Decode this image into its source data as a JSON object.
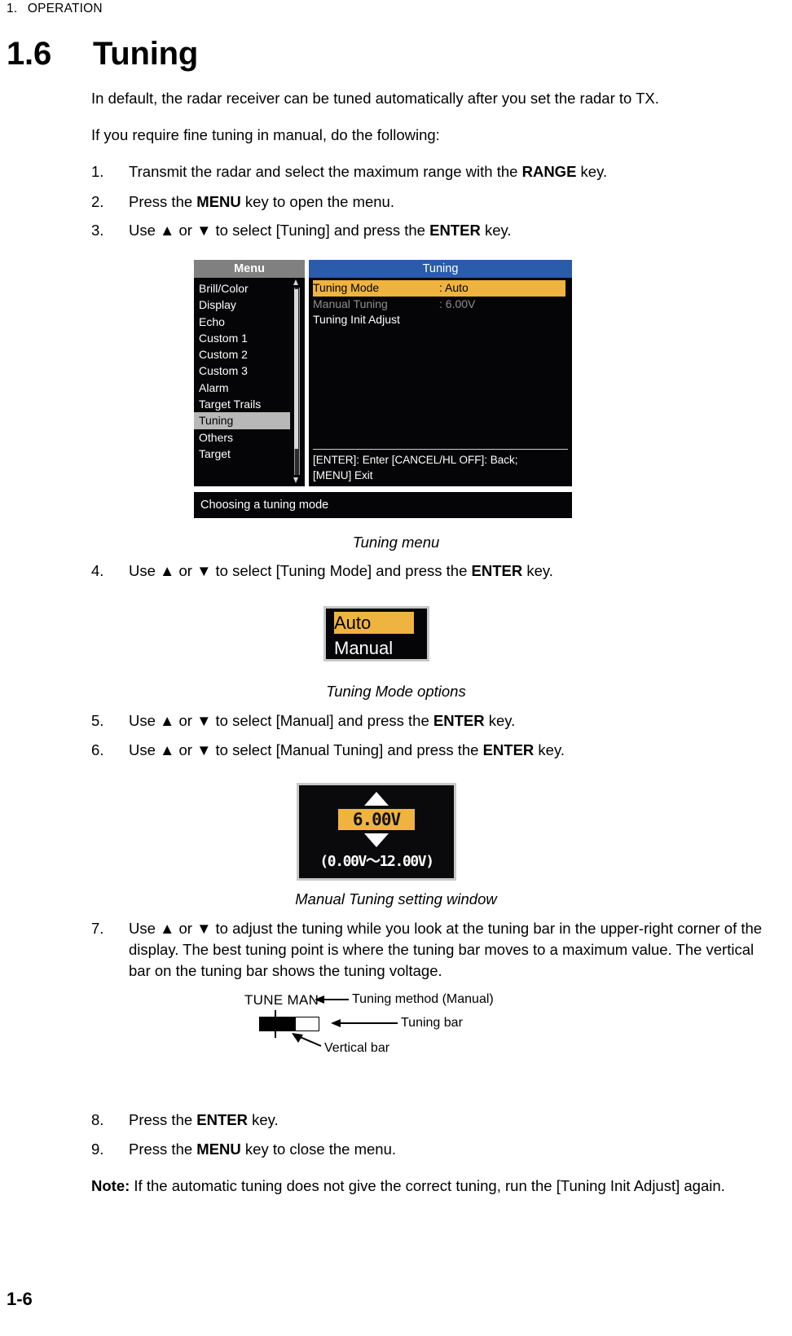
{
  "running_head": {
    "number": "1.",
    "title": "OPERATION"
  },
  "section": {
    "number": "1.6",
    "title": "Tuning"
  },
  "intro": {
    "paragraph1": "In default, the radar receiver can be tuned automatically after you set the radar to TX.",
    "paragraph2": "If you require fine tuning in manual, do the following:"
  },
  "steps": {
    "s1": {
      "num": "1.",
      "pre": "Transmit the radar and select the maximum range with the ",
      "key": "RANGE",
      "post": " key."
    },
    "s2": {
      "num": "2.",
      "pre": "Press the ",
      "key": "MENU",
      "post": " key to open the menu."
    },
    "s3": {
      "num": "3.",
      "pre": "Use ▲ or ▼ to select [Tuning] and press the ",
      "key": "ENTER",
      "post": " key."
    },
    "s4": {
      "num": "4.",
      "pre": "Use ▲ or ▼ to select [Tuning Mode] and press the ",
      "key": "ENTER",
      "post": " key."
    },
    "s5": {
      "num": "5.",
      "pre": "Use ▲ or ▼ to select [Manual] and press the ",
      "key": "ENTER",
      "post": " key."
    },
    "s6": {
      "num": "6.",
      "pre": "Use ▲ or ▼ to select [Manual Tuning] and press the ",
      "key": "ENTER",
      "post": " key."
    },
    "s7": {
      "num": "7.",
      "text": "Use ▲ or ▼ to adjust the tuning while you look at the tuning bar in the upper-right corner of the display. The best tuning point is where the tuning bar moves to a maximum value. The vertical bar on the tuning bar shows the tuning voltage."
    },
    "s8": {
      "num": "8.",
      "pre": "Press the ",
      "key": "ENTER",
      "post": " key."
    },
    "s9": {
      "num": "9.",
      "pre": "Press the ",
      "key": "MENU",
      "post": " key to close the menu."
    }
  },
  "note": {
    "label": "Note:",
    "text": " If the automatic tuning does not give the correct tuning, run the [Tuning Init Adjust] again."
  },
  "menu_screenshot": {
    "caption": "Tuning menu",
    "left_panel": {
      "title": "Menu",
      "items": [
        {
          "label": "Brill/Color",
          "selected": false
        },
        {
          "label": "Display",
          "selected": false
        },
        {
          "label": "Echo",
          "selected": false
        },
        {
          "label": "Custom 1",
          "selected": false
        },
        {
          "label": "Custom 2",
          "selected": false
        },
        {
          "label": "Custom 3",
          "selected": false
        },
        {
          "label": "Alarm",
          "selected": false
        },
        {
          "label": "Target Trails",
          "selected": false
        },
        {
          "label": "Tuning",
          "selected": true
        },
        {
          "label": "Others",
          "selected": false
        },
        {
          "label": "Target",
          "selected": false
        }
      ]
    },
    "right_panel": {
      "title": "Tuning",
      "rows": [
        {
          "label": "Tuning Mode",
          "value": ": Auto",
          "state": "highlighted"
        },
        {
          "label": "Manual Tuning",
          "value": ": 6.00V",
          "state": "disabled"
        },
        {
          "label": "Tuning Init Adjust",
          "value": "",
          "state": "normal"
        }
      ],
      "guide_line1": "[ENTER]: Enter [CANCEL/HL OFF]: Back;",
      "guide_line2": "[MENU] Exit"
    },
    "status_bar": "Choosing a tuning mode",
    "colors": {
      "title_left": "#808080",
      "title_right": "#2a5cab",
      "highlight": "#efb340",
      "selection": "#b8b8b8",
      "background": "#050507"
    }
  },
  "tuning_mode_options": {
    "caption": "Tuning Mode options",
    "options": [
      {
        "label": "Auto",
        "selected": true
      },
      {
        "label": "Manual",
        "selected": false
      }
    ]
  },
  "manual_tuning_window": {
    "caption": "Manual Tuning setting window",
    "up_arrow": "▲",
    "value": "6.00V",
    "down_arrow": "▼",
    "range": "(0.00V～12.00V)"
  },
  "tuning_bar_diagram": {
    "display_label": "TUNE MAN",
    "callout_method": "Tuning method (Manual)",
    "callout_bar": "Tuning bar",
    "callout_vertical": "Vertical bar"
  },
  "footer": {
    "page": "1-6"
  }
}
